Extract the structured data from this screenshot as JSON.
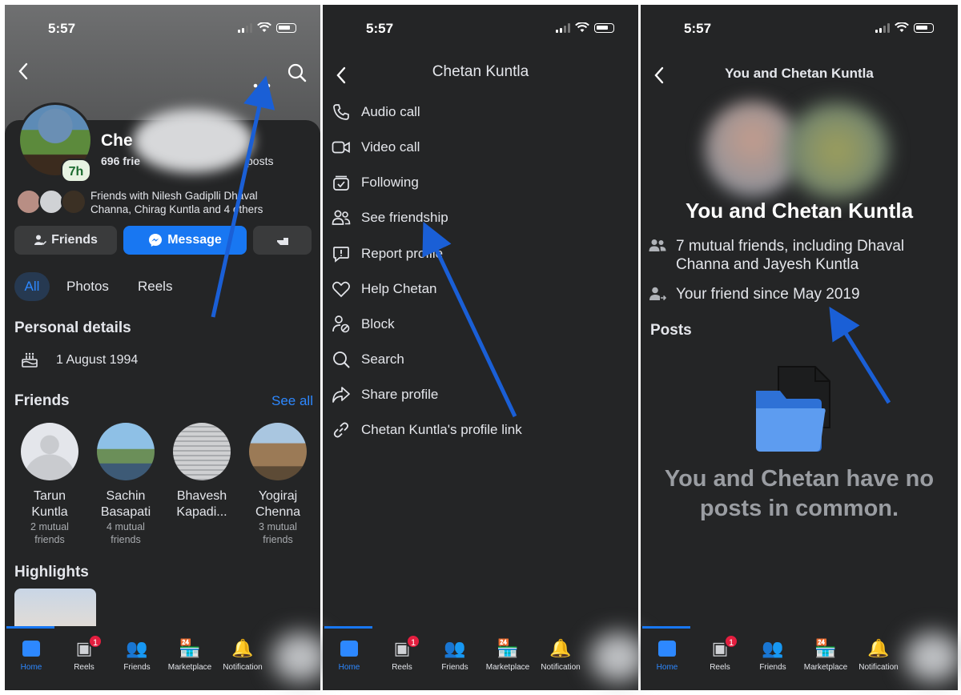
{
  "status": {
    "time": "5:57"
  },
  "profile": {
    "name_visible": "Che",
    "stats_friends": "696 frie",
    "stats_posts": "posts",
    "story_badge": "7h",
    "mutual_line_1": "Friends with Nilesh Gadiplli Dhaval",
    "mutual_line_2": "Channa, Chirag Kuntla and 4 others",
    "friends_button": "Friends",
    "message_button": "Message",
    "tabs": [
      "All",
      "Photos",
      "Reels"
    ],
    "personal_details_title": "Personal details",
    "birthday": "1 August 1994",
    "friends_title": "Friends",
    "see_all": "See all",
    "friends": [
      {
        "name1": "Tarun",
        "name2": "Kuntla",
        "mutual1": "2 mutual",
        "mutual2": "friends"
      },
      {
        "name1": "Sachin",
        "name2": "Basapati",
        "mutual1": "4 mutual",
        "mutual2": "friends"
      },
      {
        "name1": "Bhavesh",
        "name2": "Kapadi...",
        "mutual1": "",
        "mutual2": ""
      },
      {
        "name1": "Yogiraj",
        "name2": "Chenna",
        "mutual1": "3 mutual",
        "mutual2": "friends"
      }
    ],
    "highlights_title": "Highlights"
  },
  "menu": {
    "title": "Chetan Kuntla",
    "items": [
      {
        "label": "Audio call"
      },
      {
        "label": "Video call"
      },
      {
        "label": "Following"
      },
      {
        "label": "See friendship"
      },
      {
        "label": "Report profile"
      },
      {
        "label": "Help Chetan"
      },
      {
        "label": "Block"
      },
      {
        "label": "Search"
      },
      {
        "label": "Share profile"
      },
      {
        "label": "Chetan Kuntla's profile link"
      }
    ]
  },
  "friendship": {
    "header_title": "You and Chetan Kuntla",
    "big_title": "You and Chetan Kuntla",
    "mutual_line_1": "7 mutual friends, including Dhaval",
    "mutual_line_2": "Channa and Jayesh Kuntla",
    "friend_since": "Your friend since May 2019",
    "posts_title": "Posts",
    "empty_line_1": "You and Chetan have no",
    "empty_line_2": "posts in common."
  },
  "bottom_nav": {
    "items": [
      {
        "label": "Home",
        "icon": "home-icon"
      },
      {
        "label": "Reels",
        "icon": "reels-icon",
        "badge": "1"
      },
      {
        "label": "Friends",
        "icon": "friends-icon"
      },
      {
        "label": "Marketplace",
        "icon": "marketplace-icon"
      },
      {
        "label": "Notification",
        "icon": "bell-icon"
      }
    ]
  },
  "colors": {
    "accent": "#1877f2",
    "background": "#242526",
    "annotation_arrow": "#1a5fd6"
  }
}
